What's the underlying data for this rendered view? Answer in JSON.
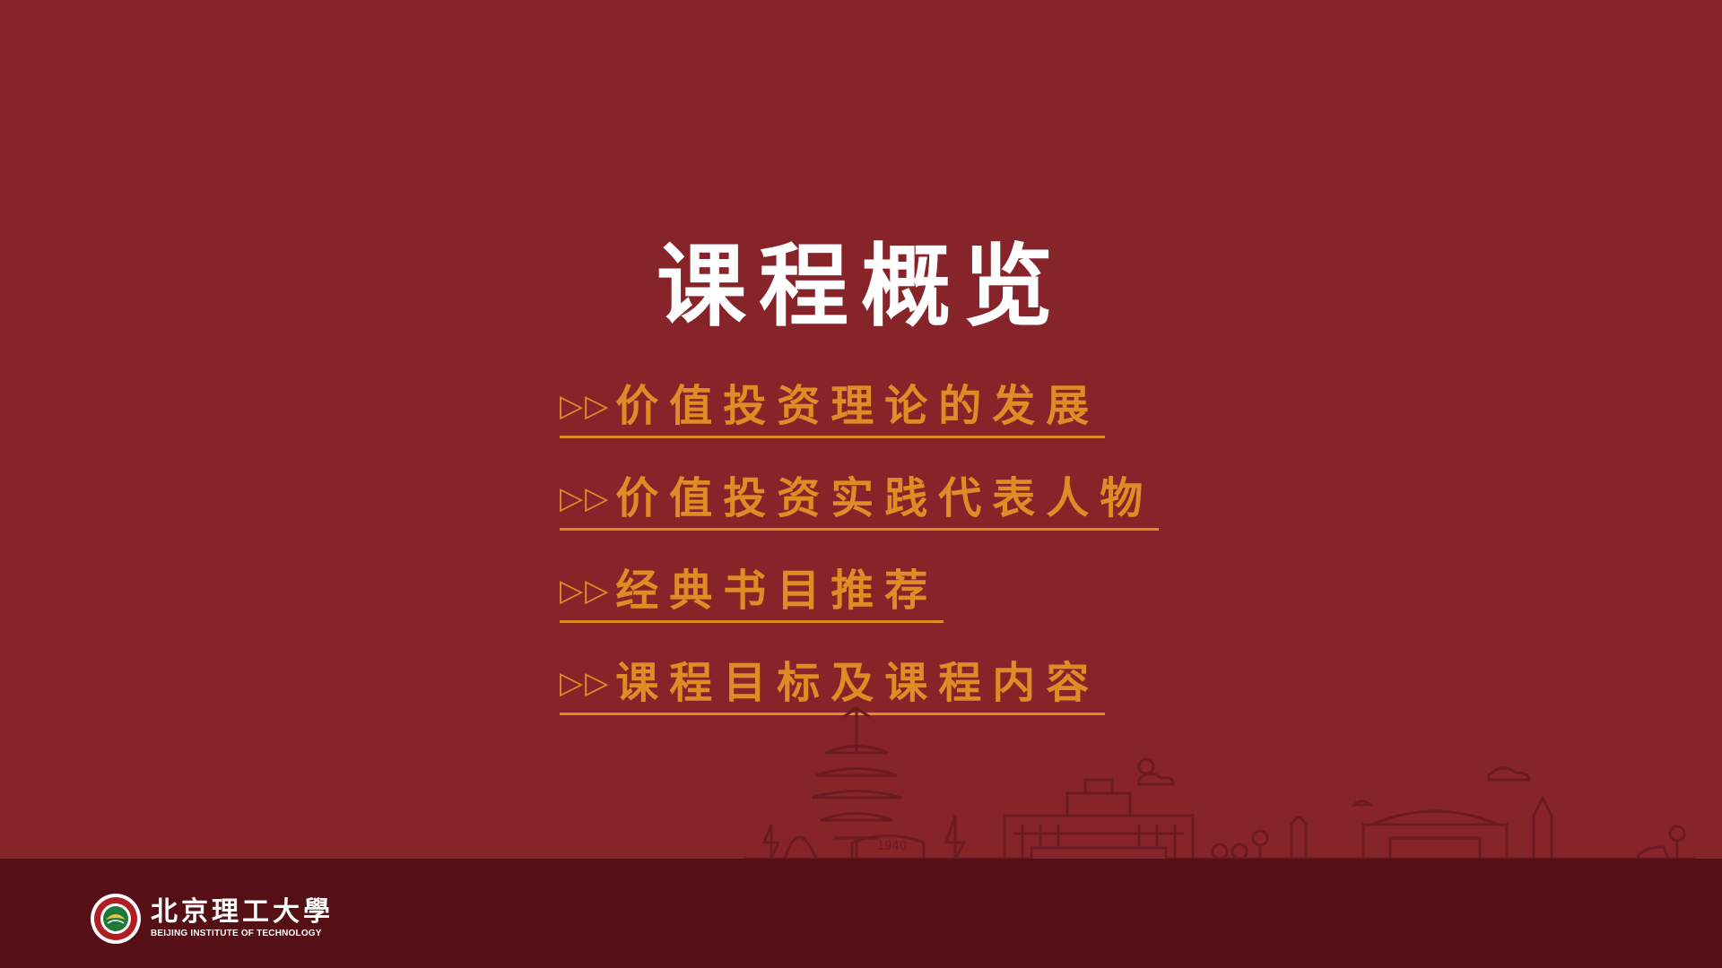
{
  "slide": {
    "title": "课程概览",
    "menu": [
      {
        "marker": "▷▷",
        "label": "价值投资理论的发展"
      },
      {
        "marker": "▷▷",
        "label": "价值投资实践代表人物"
      },
      {
        "marker": "▷▷",
        "label": "经典书目推荐"
      },
      {
        "marker": "▷▷",
        "label": "课程目标及课程内容"
      }
    ]
  },
  "footer": {
    "logo_cn": "北京理工大學",
    "logo_en": "BEIJING INSTITUTE OF TECHNOLOGY",
    "emblem_icon": "university-emblem-icon"
  },
  "decor": {
    "skyline_icon": "campus-skyline-illustration",
    "skyline_year": "1940"
  },
  "colors": {
    "background": "#87242a",
    "footer": "#541015",
    "title": "#ffffff",
    "link": "#e08b26"
  }
}
